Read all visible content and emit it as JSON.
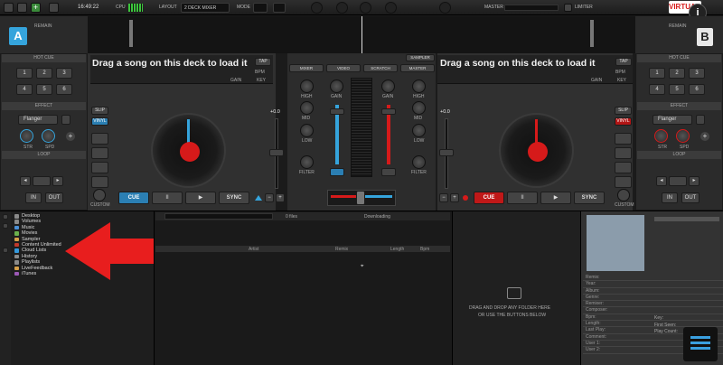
{
  "topbar": {
    "clock": "16:49:22",
    "cpu_label": "CPU",
    "layout_label": "LAYOUT",
    "layout_value": "2 DECK MIXER",
    "mode_label": "MODE",
    "master_label": "MASTER",
    "limiter_label": "LIMITER",
    "brand_text": "VIRTUAL DJ",
    "info_icon_text": "i"
  },
  "deck_a": {
    "letter": "A",
    "remain_label": "REMAIN",
    "song_prompt": "Drag a song on this deck to load it",
    "tap": "TAP",
    "bpm": "BPM",
    "gain": "GAIN",
    "key": "KEY",
    "hotcue_title": "HOT CUE",
    "hotcues": [
      "1",
      "2",
      "3",
      "4",
      "5",
      "6"
    ],
    "effect_title": "EFFECT",
    "effect_value": "Flanger",
    "str": "STR",
    "spd": "SPD",
    "loop_title": "LOOP",
    "loop_in": "IN",
    "loop_out": "OUT",
    "slip": "SLIP",
    "vinyl": "VINYL",
    "custom": "CUSTOM",
    "cue": "CUE",
    "pause": "II",
    "play": "▶",
    "sync": "SYNC",
    "pitch": "+0.0"
  },
  "deck_b": {
    "letter": "B",
    "remain_label": "REMAIN",
    "song_prompt": "Drag a song on this deck to load it",
    "tap": "TAP",
    "bpm": "BPM",
    "gain": "GAIN",
    "key": "KEY",
    "hotcue_title": "HOT CUE",
    "hotcues": [
      "1",
      "2",
      "3",
      "4",
      "5",
      "6"
    ],
    "effect_title": "EFFECT",
    "effect_value": "Flanger",
    "str": "STR",
    "spd": "SPD",
    "loop_title": "LOOP",
    "loop_in": "IN",
    "loop_out": "OUT",
    "slip": "SLIP",
    "vinyl": "VINYL",
    "custom": "CUSTOM",
    "cue": "CUE",
    "pause": "II",
    "play": "▶",
    "sync": "SYNC",
    "pitch": "+0.0"
  },
  "mixer": {
    "tabs": [
      "MIXER",
      "VIDEO",
      "SCRATCH",
      "MASTER"
    ],
    "sampler": "SAMPLER",
    "high": "HIGH",
    "mid": "MID",
    "low": "LOW",
    "filter": "FILTER",
    "gain": "GAIN"
  },
  "browser": {
    "folders": [
      "Desktop",
      "Volumes",
      "Music",
      "Movies",
      "Sampler",
      "Content Unlimited",
      "Cloud Lists",
      "History",
      "Playlists",
      "LiveFeedback",
      "iTunes"
    ],
    "files_count": "0 files",
    "downloading": "Downloading",
    "columns": [
      "Artist",
      "Remix",
      "Length",
      "Bpm"
    ],
    "drop_line1": "DRAG AND DROP ANY FOLDER HERE",
    "drop_line2": "OR USE THE BUTTONS BELOW"
  },
  "info_panel": {
    "fields": [
      "Remix:",
      "Year:",
      "Album:",
      "Genre:",
      "Remixer:",
      "Composer:",
      "Bpm:",
      "Length:",
      "Last Play:",
      "Comment:",
      "User 1:",
      "User 2:"
    ],
    "fields_right": [
      "Key:",
      "First Seen:",
      "Play Count:"
    ]
  },
  "colors": {
    "deck_a_accent": "#35a4dc",
    "deck_b_accent": "#d61a1a",
    "arrow": "#e81e1e"
  }
}
